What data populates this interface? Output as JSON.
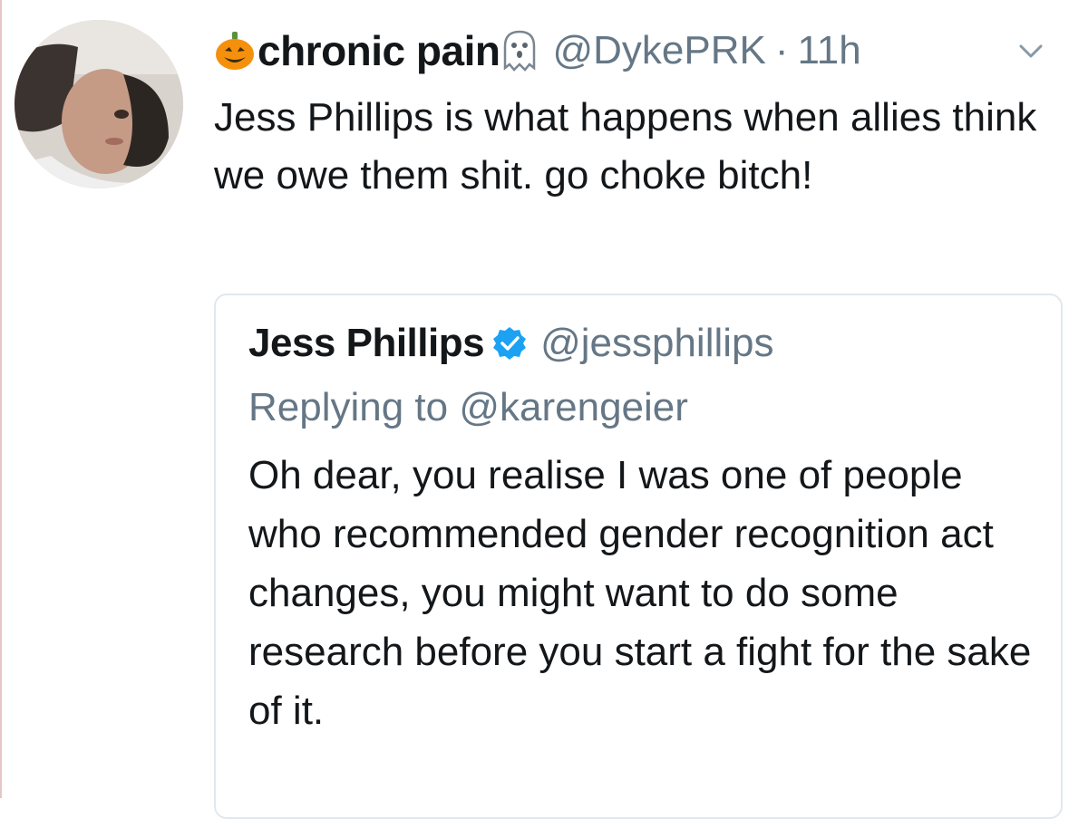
{
  "tweet": {
    "author_name": "chronic pain",
    "author_emoji_prefix": "jack-o-lantern-icon",
    "author_emoji_suffix": "ghost-icon",
    "handle": "@DykePRK",
    "separator": "·",
    "time": "11h",
    "text": "Jess Phillips is what happens when allies think we owe them shit. go choke bitch!",
    "menu_icon": "chevron-down-icon"
  },
  "quoted_tweet": {
    "author_name": "Jess Phillips",
    "verified_icon": "verified-badge-icon",
    "handle": "@jessphillips",
    "replying_to": "Replying to @karengeier",
    "text": "Oh dear, you realise I was one of people who recommended gender recognition act changes, you might want to do some research before you start a fight for the sake of it."
  },
  "colors": {
    "text_primary": "#14171a",
    "text_secondary": "#657786",
    "verified_blue": "#1da1f2",
    "border": "#e1e8ed",
    "pumpkin_orange": "#f4900c"
  }
}
